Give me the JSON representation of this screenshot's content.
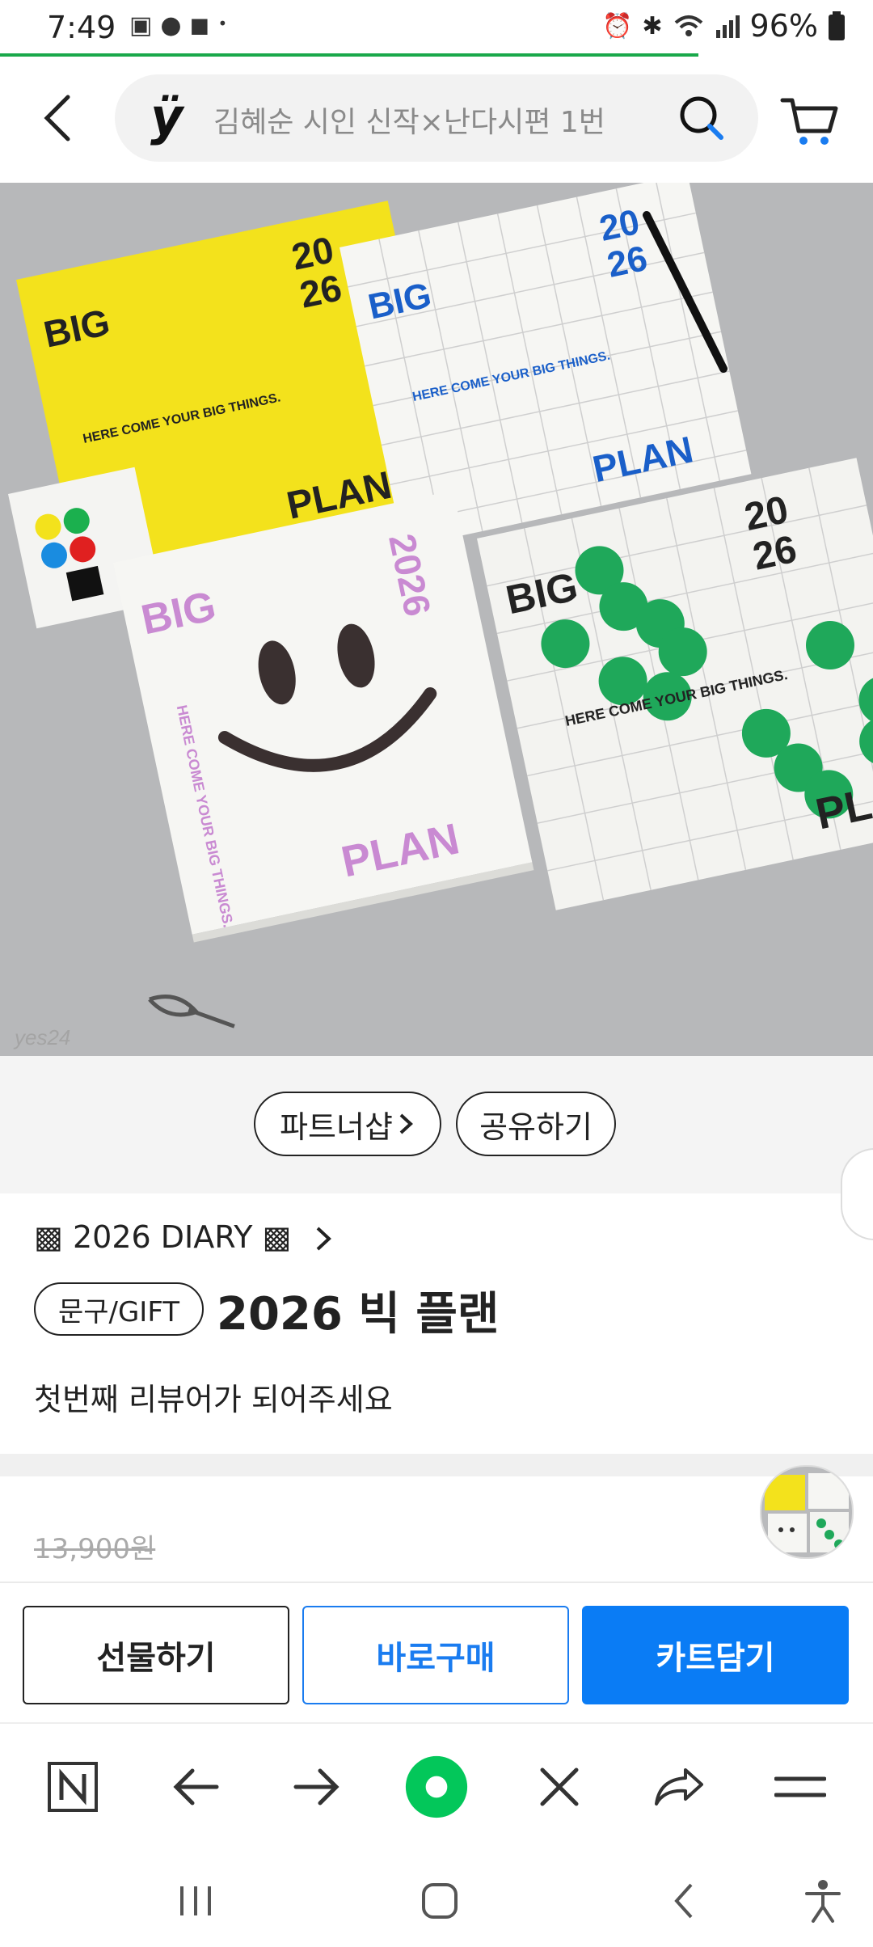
{
  "status_bar": {
    "time": "7:49",
    "battery": "96%"
  },
  "header": {
    "logo": "ÿ",
    "search_placeholder": "김혜순 시인 신작×난다시편 1번"
  },
  "product_image": {
    "big": "BIG",
    "year_top": "20",
    "year_bottom": "26",
    "year_vertical": "2026",
    "plan": "PLAN",
    "tagline": "HERE COME YOUR BIG THINGS.",
    "partial_plan": "PLA",
    "watermark": "yes24"
  },
  "actions": {
    "partner_shop": "파트너샵",
    "share": "공유하기"
  },
  "product": {
    "category": "▩ 2026 DIARY ▩",
    "badge": "문구/GIFT",
    "title": "2026 빅 플랜",
    "review_prompt": "첫번째 리뷰어가 되어주세요",
    "original_price": "13,900원"
  },
  "purchase_buttons": {
    "gift": "선물하기",
    "buy_now": "바로구매",
    "add_to_cart": "카트담기"
  },
  "colors": {
    "accent_blue": "#0a7cf5",
    "progress_green": "#19a84a",
    "naver_green": "#03c75a"
  }
}
